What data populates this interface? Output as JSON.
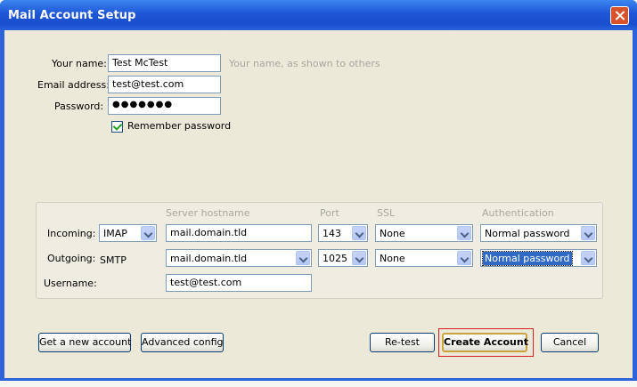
{
  "window": {
    "title": "Mail Account Setup"
  },
  "identity": {
    "name_label": "Your name:",
    "name_value": "Test McTest",
    "name_hint": "Your name, as shown to others",
    "email_label": "Email address:",
    "email_value": "test@test.com",
    "password_label": "Password:",
    "password_value": "●●●●●●●",
    "remember_label": "Remember password",
    "remember_checked": true
  },
  "server": {
    "headers": {
      "hostname": "Server hostname",
      "port": "Port",
      "ssl": "SSL",
      "auth": "Authentication"
    },
    "incoming": {
      "label": "Incoming:",
      "protocol": "IMAP",
      "hostname": "mail.domain.tld",
      "port": "143",
      "ssl": "None",
      "auth": "Normal password"
    },
    "outgoing": {
      "label": "Outgoing:",
      "protocol": "SMTP",
      "hostname": "mail.domain.tld",
      "port": "1025",
      "ssl": "None",
      "auth": "Normal password"
    },
    "username_label": "Username:",
    "username_value": "test@test.com"
  },
  "buttons": {
    "get_account": "Get a new account",
    "advanced": "Advanced config",
    "retest": "Re-test",
    "create": "Create Account",
    "cancel": "Cancel"
  },
  "colors": {
    "titlebar": "#1d56d6",
    "dialog": "#ece9d8",
    "focus": "#d82020"
  }
}
